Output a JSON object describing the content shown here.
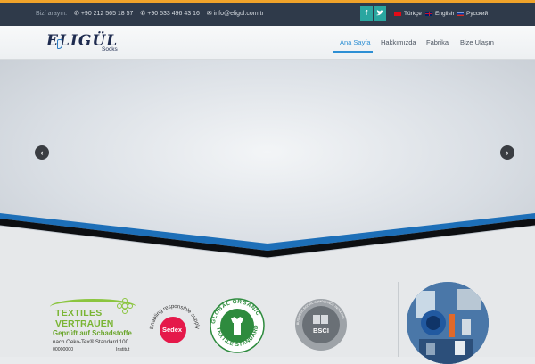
{
  "topbar": {
    "contact_label": "Bizí arayın:",
    "phone1": "+90 212 565 18 57",
    "phone2": "+90 533 496 43 16",
    "email": "info@eligul.com.tr",
    "social": [
      "f",
      "t"
    ],
    "languages": [
      "Türkçe",
      "English",
      "Русский"
    ]
  },
  "logo": {
    "brand": "ELIGÜL",
    "sub": "Socks"
  },
  "nav": {
    "items": [
      "Ana Sayfa",
      "Hakkımızda",
      "Fabrika",
      "Bize Ulaşın"
    ],
    "active_index": 0
  },
  "slider": {
    "prev": "‹",
    "next": "›"
  },
  "certificates": {
    "oeko": {
      "line1": "TEXTILES",
      "line2": "VERTRAUEN",
      "line3": "Geprüft auf Schadstoffe",
      "line4": "nach Oeko-Tex® Standard 100",
      "number": "00000000",
      "institut": "Institut"
    },
    "sedex": {
      "arc_text": "Enabling responsible supply chains",
      "name": "Sedex"
    },
    "gots": {
      "arc_top": "GLOBAL ORGANIC",
      "arc_bottom": "TEXTILE STANDARD"
    },
    "bsci": {
      "name": "BSCI",
      "arc_text": "BUSINESS SOCIAL COMPLIANCE INITIATIVE"
    }
  },
  "colors": {
    "accent": "#f0a32a",
    "topbar_bg": "#2f3a4a",
    "nav_active": "#2d8fd4",
    "social_bg": "#2aa6a0",
    "stripe_blue": "#1d6fb8",
    "oeko_green": "#7ab534",
    "sedex_red": "#e5194a",
    "gots_green": "#2e8b3e"
  }
}
